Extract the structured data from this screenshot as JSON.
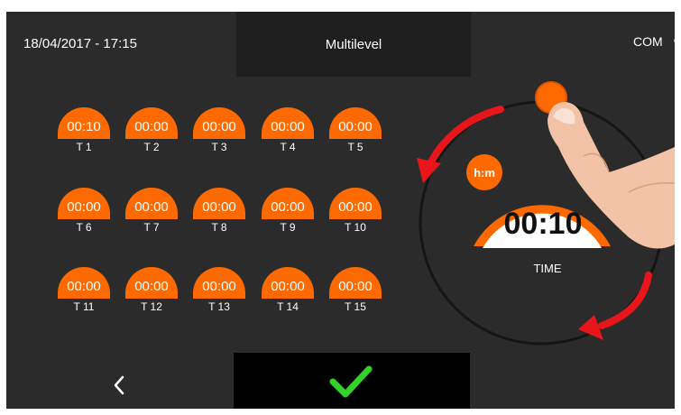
{
  "header": {
    "datetime": "18/04/2017 - 17:15",
    "title": "Multilevel",
    "status_label": "COM",
    "status_color": "#8cc63f"
  },
  "accent_color": "#ff6a00",
  "timers": [
    {
      "label": "T 1",
      "value": "00:10"
    },
    {
      "label": "T 2",
      "value": "00:00"
    },
    {
      "label": "T 3",
      "value": "00:00"
    },
    {
      "label": "T 4",
      "value": "00:00"
    },
    {
      "label": "T 5",
      "value": "00:00"
    },
    {
      "label": "T 6",
      "value": "00:00"
    },
    {
      "label": "T 7",
      "value": "00:00"
    },
    {
      "label": "T 8",
      "value": "00:00"
    },
    {
      "label": "T 9",
      "value": "00:00"
    },
    {
      "label": "T 10",
      "value": "00:00"
    },
    {
      "label": "T 11",
      "value": "00:00"
    },
    {
      "label": "T 12",
      "value": "00:00"
    },
    {
      "label": "T 13",
      "value": "00:00"
    },
    {
      "label": "T 14",
      "value": "00:00"
    },
    {
      "label": "T 15",
      "value": "00:00"
    }
  ],
  "dial": {
    "unit_badge": "h:m",
    "value": "00:10",
    "caption": "TIME"
  },
  "footer": {
    "back_icon": "chevron-left-icon",
    "confirm_icon": "checkmark-icon"
  }
}
